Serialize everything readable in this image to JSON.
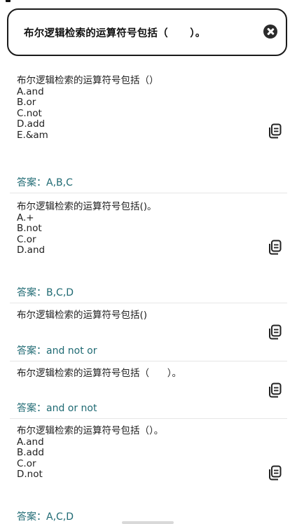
{
  "search": {
    "value": "布尔逻辑检索的运算符号包括（      ）。",
    "clear_icon": "close-circle-icon"
  },
  "results": [
    {
      "question_lines": [
        "布尔逻辑检索的运算符号包括（）",
        "A.and",
        "B.or",
        "C.not",
        "D.add",
        "E.&am"
      ],
      "answer": "答案：A,B,C",
      "icon": "copy-icon"
    },
    {
      "question_lines": [
        "布尔逻辑检索的运算符号包括()。",
        "A.+",
        "B.not",
        "C.or",
        "D.and"
      ],
      "answer": "答案：B,C,D",
      "icon": "copy-icon"
    },
    {
      "question_lines": [
        "布尔逻辑检索的运算符号包括()"
      ],
      "answer": "答案：and not or",
      "icon": "copy-icon"
    },
    {
      "question_lines": [
        "布尔逻辑检索的运算符号包括（      ）。"
      ],
      "answer": "答案：and or not",
      "icon": "copy-icon"
    },
    {
      "question_lines": [
        "布尔逻辑检索的运算符号包括（）。",
        "A.and",
        "B.add",
        "C.or",
        "D.not"
      ],
      "answer": "答案：A,C,D",
      "icon": "copy-icon"
    }
  ],
  "colors": {
    "answer": "#1f6a73",
    "border": "#1a1a1a"
  }
}
